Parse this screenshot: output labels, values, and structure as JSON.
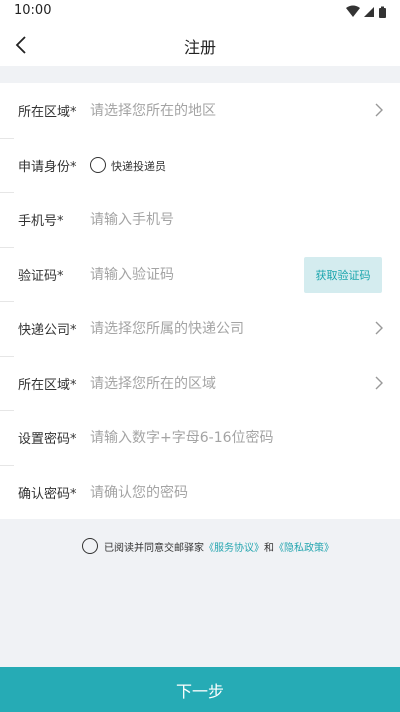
{
  "status_bar": {
    "time": "10:00",
    "icons": [
      "wifi-icon",
      "signal-icon",
      "battery-icon"
    ]
  },
  "nav": {
    "title": "注册",
    "back_icon": "chevron-left-icon"
  },
  "form": {
    "region": {
      "label": "所在区域*",
      "placeholder": "请选择您所在的地区"
    },
    "identity": {
      "label": "申请身份*",
      "option": "快递投递员",
      "selected": false
    },
    "phone": {
      "label": "手机号*",
      "placeholder": "请输入手机号"
    },
    "code": {
      "label": "验证码*",
      "placeholder": "请输入验证码",
      "button": "获取验证码"
    },
    "company": {
      "label": "快递公司*",
      "placeholder": "请选择您所属的快递公司"
    },
    "area": {
      "label": "所在区域*",
      "placeholder": "请选择您所在的区域"
    },
    "password": {
      "label": "设置密码*",
      "placeholder": "请输入数字+字母6-16位密码"
    },
    "confirm": {
      "label": "确认密码*",
      "placeholder": "请确认您的密码"
    }
  },
  "agreement": {
    "prefix": "已阅读并同意交邮驿家",
    "service_link": "《服务协议》",
    "and": "和",
    "privacy_link": "《隐私政策》",
    "checked": false
  },
  "next_button": "下一步",
  "colors": {
    "accent": "#26abb5",
    "code_button_bg": "#d4ecef",
    "background": "#f0f2f5"
  }
}
